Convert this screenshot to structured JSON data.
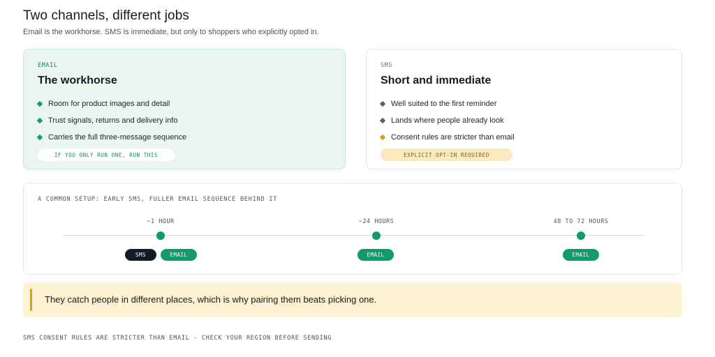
{
  "header": {
    "title": "Two channels, different jobs",
    "subtitle": "Email is the workhorse. SMS is immediate, but only to shoppers who explicitly opted in."
  },
  "cards": {
    "email": {
      "kicker": "EMAIL",
      "title": "The workhorse",
      "bullets": [
        "Room for product images and detail",
        "Trust signals, returns and delivery info",
        "Carries the full three-message sequence"
      ],
      "pill": "IF YOU ONLY RUN ONE, RUN THIS"
    },
    "sms": {
      "kicker": "SMS",
      "title": "Short and immediate",
      "bullets": [
        "Well suited to the first reminder",
        "Lands where people already look",
        "Consent rules are stricter than email"
      ],
      "pill": "EXPLICIT OPT-IN REQUIRED"
    }
  },
  "timeline": {
    "label": "A COMMON SETUP: EARLY SMS, FULLER EMAIL SEQUENCE BEHIND IT",
    "steps": [
      {
        "time": "~1 HOUR",
        "tags": [
          "SMS",
          "EMAIL"
        ]
      },
      {
        "time": "~24 HOURS",
        "tags": [
          "EMAIL"
        ]
      },
      {
        "time": "48 TO 72 HOURS",
        "tags": [
          "EMAIL"
        ]
      }
    ]
  },
  "callout": {
    "text": "They catch people in different places, which is why pairing them beats picking one."
  },
  "footer": {
    "note": "SMS CONSENT RULES ARE STRICTER THAN EMAIL - CHECK YOUR REGION BEFORE SENDING"
  },
  "colors": {
    "email_green": "#0f9a70",
    "sms_navy": "#161b2c",
    "amber": "#d4a017",
    "email_card_bg": "#eaf5f0",
    "callout_bg": "#fdf3d3"
  }
}
